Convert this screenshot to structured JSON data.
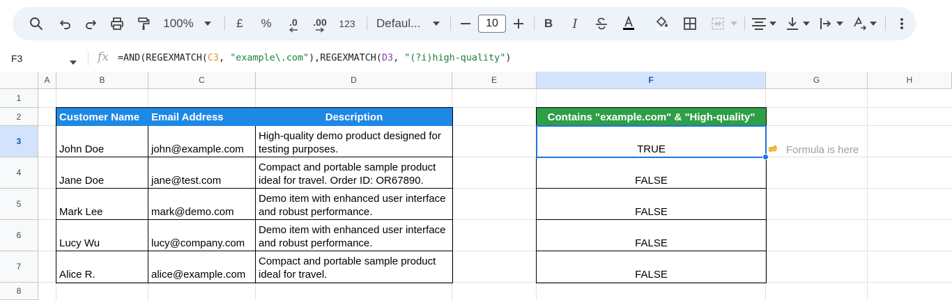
{
  "toolbar": {
    "zoom": "100%",
    "currency": "£",
    "percent": "%",
    "decrease_decimal": ".0",
    "increase_decimal": ".00",
    "number_format": "123",
    "font_name": "Defaul...",
    "font_size": "10",
    "bold": "B",
    "italic": "I"
  },
  "formula_bar": {
    "cell_ref": "F3",
    "fx": "fx",
    "formula": {
      "p1": "=AND(REGEXMATCH(",
      "ref1": "C3",
      "p2": ", ",
      "str1": "\"example\\.com\"",
      "p3": "),REGEXMATCH(",
      "ref2": "D3",
      "p4": ", ",
      "str2": "\"(?i)high-quality\"",
      "p5": ")"
    }
  },
  "colors": {
    "blue_header": "#1e88e5",
    "green_header": "#2e9e47",
    "ref1": "#e69138",
    "ref2": "#8e44ad",
    "string": "#188038",
    "selection": "#1a73e8"
  },
  "columns": [
    "A",
    "B",
    "C",
    "D",
    "E",
    "F",
    "G",
    "H"
  ],
  "rows": [
    "1",
    "2",
    "3",
    "4",
    "5",
    "6",
    "7",
    "8"
  ],
  "table": {
    "headers": [
      "Customer Name",
      "Email Address",
      "Description"
    ],
    "rows": [
      {
        "name": "John Doe",
        "email": "john@example.com",
        "description": "High-quality demo product designed for testing purposes."
      },
      {
        "name": "Jane Doe",
        "email": "jane@test.com",
        "description": "Compact and portable sample product ideal for travel. Order ID: OR67890."
      },
      {
        "name": "Mark Lee",
        "email": "mark@demo.com",
        "description": "Demo item with enhanced user interface and robust performance."
      },
      {
        "name": "Lucy Wu",
        "email": "lucy@company.com",
        "description": "Demo item with enhanced user interface and robust performance."
      },
      {
        "name": "Alice R.",
        "email": "alice@example.com",
        "description": "Compact and portable sample product ideal for travel."
      }
    ]
  },
  "result": {
    "header": "Contains \"example.com\" & \"High-quality\"",
    "values": [
      "TRUE",
      "FALSE",
      "FALSE",
      "FALSE",
      "FALSE"
    ]
  },
  "note": {
    "icon": "pointing-hand-icon",
    "text": "Formula is here"
  }
}
